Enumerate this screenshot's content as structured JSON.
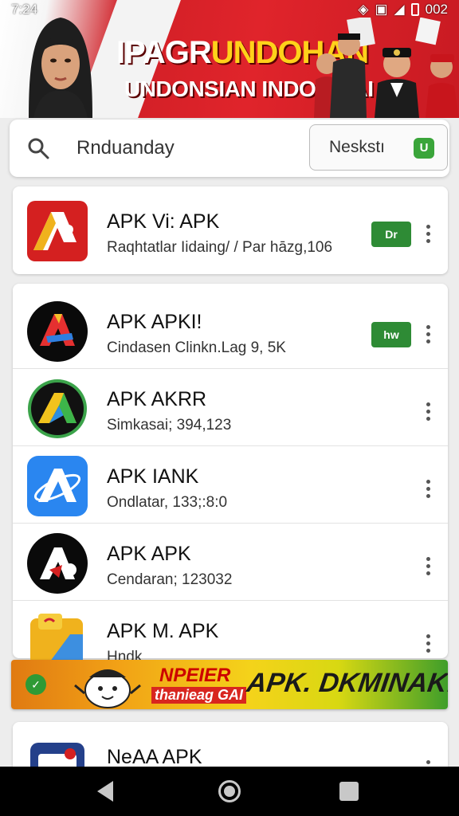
{
  "status_bar": {
    "time": "7:24",
    "right": "002"
  },
  "banner": {
    "line1_part1": "IPAGR",
    "line1_part2": "UNDOHAN",
    "line2": "UNDONSIAN INDONSIAI"
  },
  "search": {
    "value": "Rnduanday",
    "filter_label": "Neskstı",
    "filter_icon": "U"
  },
  "apps_top": [
    {
      "name": "APK Vi: APK",
      "sub": "Raqhtatlar Iidaing/ / Par hāzg,106",
      "install": "Dr"
    }
  ],
  "apps": [
    {
      "name": "APK APKI!",
      "sub": "Cindasen Clinkn.Lag 9, 5K",
      "install": "hw"
    },
    {
      "name": "APK AKRR",
      "sub": "Simkasai; 394,123"
    },
    {
      "name": "APK IANK",
      "sub": "Ondlatar, 133;:8:0"
    },
    {
      "name": "APK APK",
      "sub": "Cendaran; 123032"
    },
    {
      "name": "APK M. APK",
      "sub": "Hndk"
    }
  ],
  "ad": {
    "title1": "NPEIER",
    "title2": "thanieag GAI",
    "big": "APK. DKMINAK!"
  },
  "apps_bottom": [
    {
      "name": "NeAA APK"
    }
  ]
}
